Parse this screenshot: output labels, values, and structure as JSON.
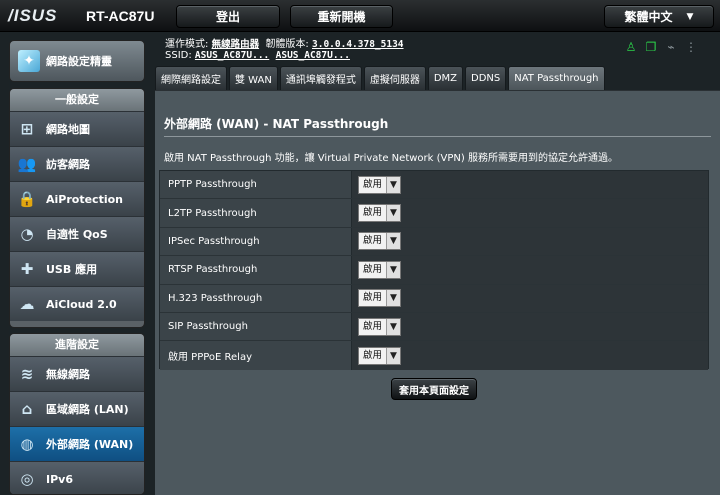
{
  "brand": {
    "logo": "/ISUS",
    "model": "RT-AC87U"
  },
  "topbar": {
    "logout": "登出",
    "reboot": "重新開機",
    "language": "繁體中文"
  },
  "status": {
    "mode_label": "運作模式:",
    "mode_value": "無線路由器",
    "firmware_label": "韌體版本:",
    "firmware_value": "3.0.0.4.378_5134",
    "ssid_label": "SSID:",
    "ssid_1": "ASUS_AC87U...",
    "ssid_2": "ASUS_AC87U..."
  },
  "sidebar": {
    "quick_setup": "網路設定精靈",
    "general_header": "一般設定",
    "general_items": [
      {
        "label": "網路地圖",
        "icon": "network-map-icon"
      },
      {
        "label": "訪客網路",
        "icon": "guest-network-icon"
      },
      {
        "label": "AiProtection",
        "icon": "lock-icon"
      },
      {
        "label": "自適性 QoS",
        "icon": "gauge-icon"
      },
      {
        "label": "USB 應用",
        "icon": "puzzle-icon"
      },
      {
        "label": "AiCloud 2.0",
        "icon": "cloud-icon"
      }
    ],
    "advanced_header": "進階設定",
    "advanced_items": [
      {
        "label": "無線網路",
        "icon": "wifi-icon"
      },
      {
        "label": "區域網路 (LAN)",
        "icon": "home-icon"
      },
      {
        "label": "外部網路 (WAN)",
        "icon": "globe-icon",
        "active": true
      },
      {
        "label": "IPv6",
        "icon": "ipv6-icon"
      }
    ]
  },
  "tabs": [
    {
      "label": "網際網路設定"
    },
    {
      "label": "雙 WAN"
    },
    {
      "label": "通訊埠觸發程式"
    },
    {
      "label": "虛擬伺服器"
    },
    {
      "label": "DMZ"
    },
    {
      "label": "DDNS"
    },
    {
      "label": "NAT Passthrough",
      "active": true
    }
  ],
  "content": {
    "title": "外部網路 (WAN) - NAT Passthrough",
    "description": "啟用 NAT Passthrough 功能，讓 Virtual Private Network (VPN) 服務所需要用到的協定允許通過。",
    "rows": [
      {
        "label": "PPTP Passthrough",
        "value": "啟用"
      },
      {
        "label": "L2TP Passthrough",
        "value": "啟用"
      },
      {
        "label": "IPSec Passthrough",
        "value": "啟用"
      },
      {
        "label": "RTSP Passthrough",
        "value": "啟用"
      },
      {
        "label": "H.323 Passthrough",
        "value": "啟用"
      },
      {
        "label": "SIP Passthrough",
        "value": "啟用"
      },
      {
        "label": "啟用 PPPoE Relay",
        "value": "啟用"
      }
    ],
    "apply": "套用本頁面設定"
  },
  "colors": {
    "active_nav": "#1d6fa8",
    "status_green": "#2bd14a"
  }
}
